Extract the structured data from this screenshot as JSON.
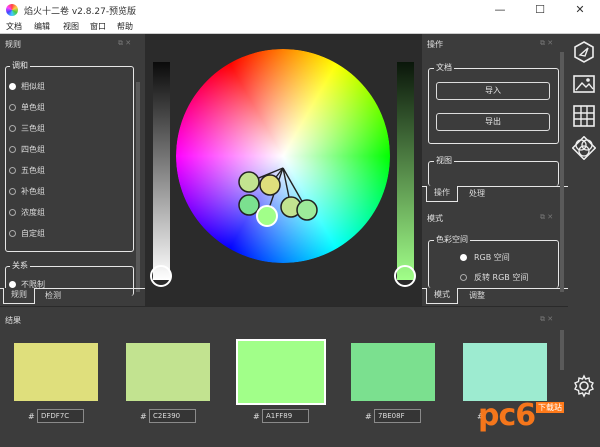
{
  "window": {
    "title": "焰火十二卷 v2.8.27-预览版",
    "minimize": "—",
    "maximize": "☐",
    "close": "✕"
  },
  "menu": [
    "文档",
    "编辑",
    "视图",
    "窗口",
    "帮助"
  ],
  "left_panel": {
    "title": "规则",
    "harmony_label": "调和",
    "harmony_options": [
      "相似组",
      "单色组",
      "三色组",
      "四色组",
      "五色组",
      "补色组",
      "浓度组",
      "自定组"
    ],
    "selected_harmony": "相似组",
    "relation_label": "关系",
    "relation_option": "不限制",
    "tabs": [
      "规则",
      "检测"
    ]
  },
  "right_panel": {
    "title": "操作",
    "document_label": "文档",
    "import_label": "导入",
    "export_label": "导出",
    "view_label": "视图",
    "tabs_top": [
      "操作",
      "处理"
    ],
    "mode_title": "模式",
    "colorspace_label": "色彩空间",
    "colorspace_options": [
      "RGB 空间",
      "反转 RGB 空间"
    ],
    "selected_colorspace": "RGB 空间",
    "tabs_bottom": [
      "模式",
      "调整"
    ]
  },
  "toolbar_icons": [
    "navigate-icon",
    "image-icon",
    "grid-icon",
    "blend-icon",
    "settings-icon"
  ],
  "results": {
    "title": "结果",
    "hash": "#",
    "swatches": [
      {
        "hex": "DFDF7C",
        "color": "#DFDF7C"
      },
      {
        "hex": "C2E390",
        "color": "#C2E390"
      },
      {
        "hex": "A1FF89",
        "color": "#A1FF89"
      },
      {
        "hex": "7BE08F",
        "color": "#7BE08F"
      },
      {
        "hex": "",
        "color": "#9DEBD0"
      }
    ]
  },
  "watermark": {
    "text": "pc6",
    "sub": "下载站"
  }
}
